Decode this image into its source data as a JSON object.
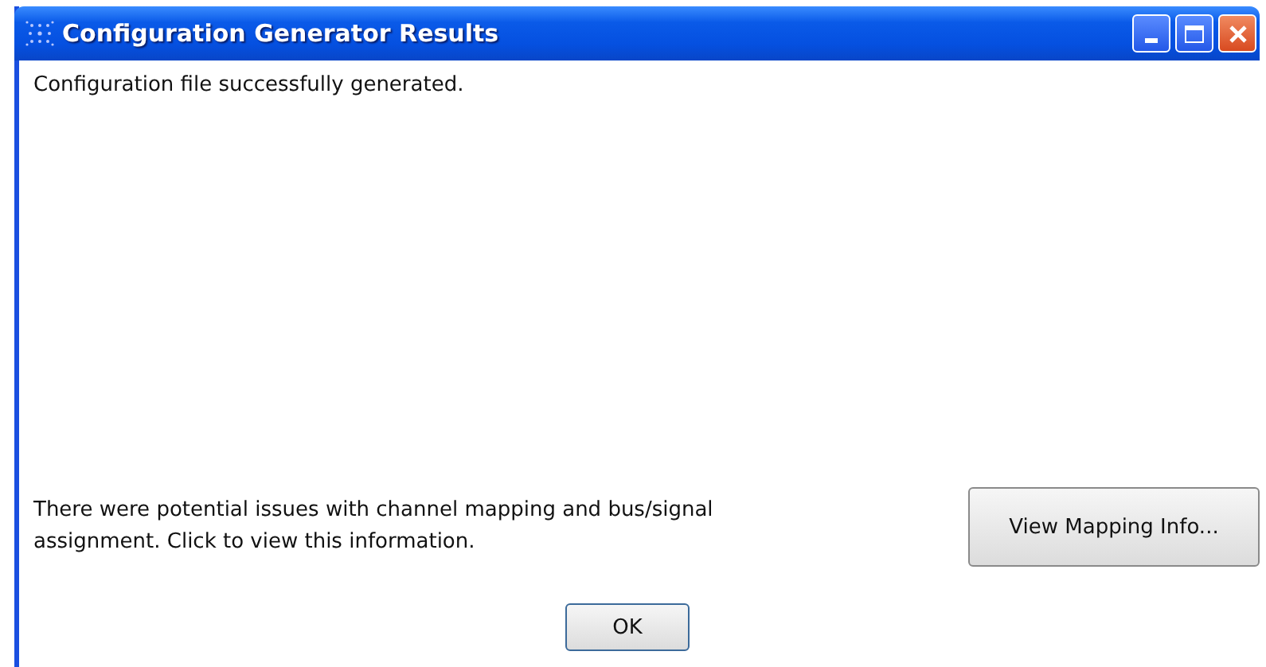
{
  "window": {
    "title": "Configuration Generator Results"
  },
  "message": "Configuration file successfully generated.",
  "notice": "There were potential issues with channel mapping and bus/signal assignment. Click to view this information.",
  "buttons": [
    {
      "kind": "mapping",
      "label": "View Mapping Info..."
    },
    {
      "kind": "ok",
      "label": "OK"
    }
  ]
}
